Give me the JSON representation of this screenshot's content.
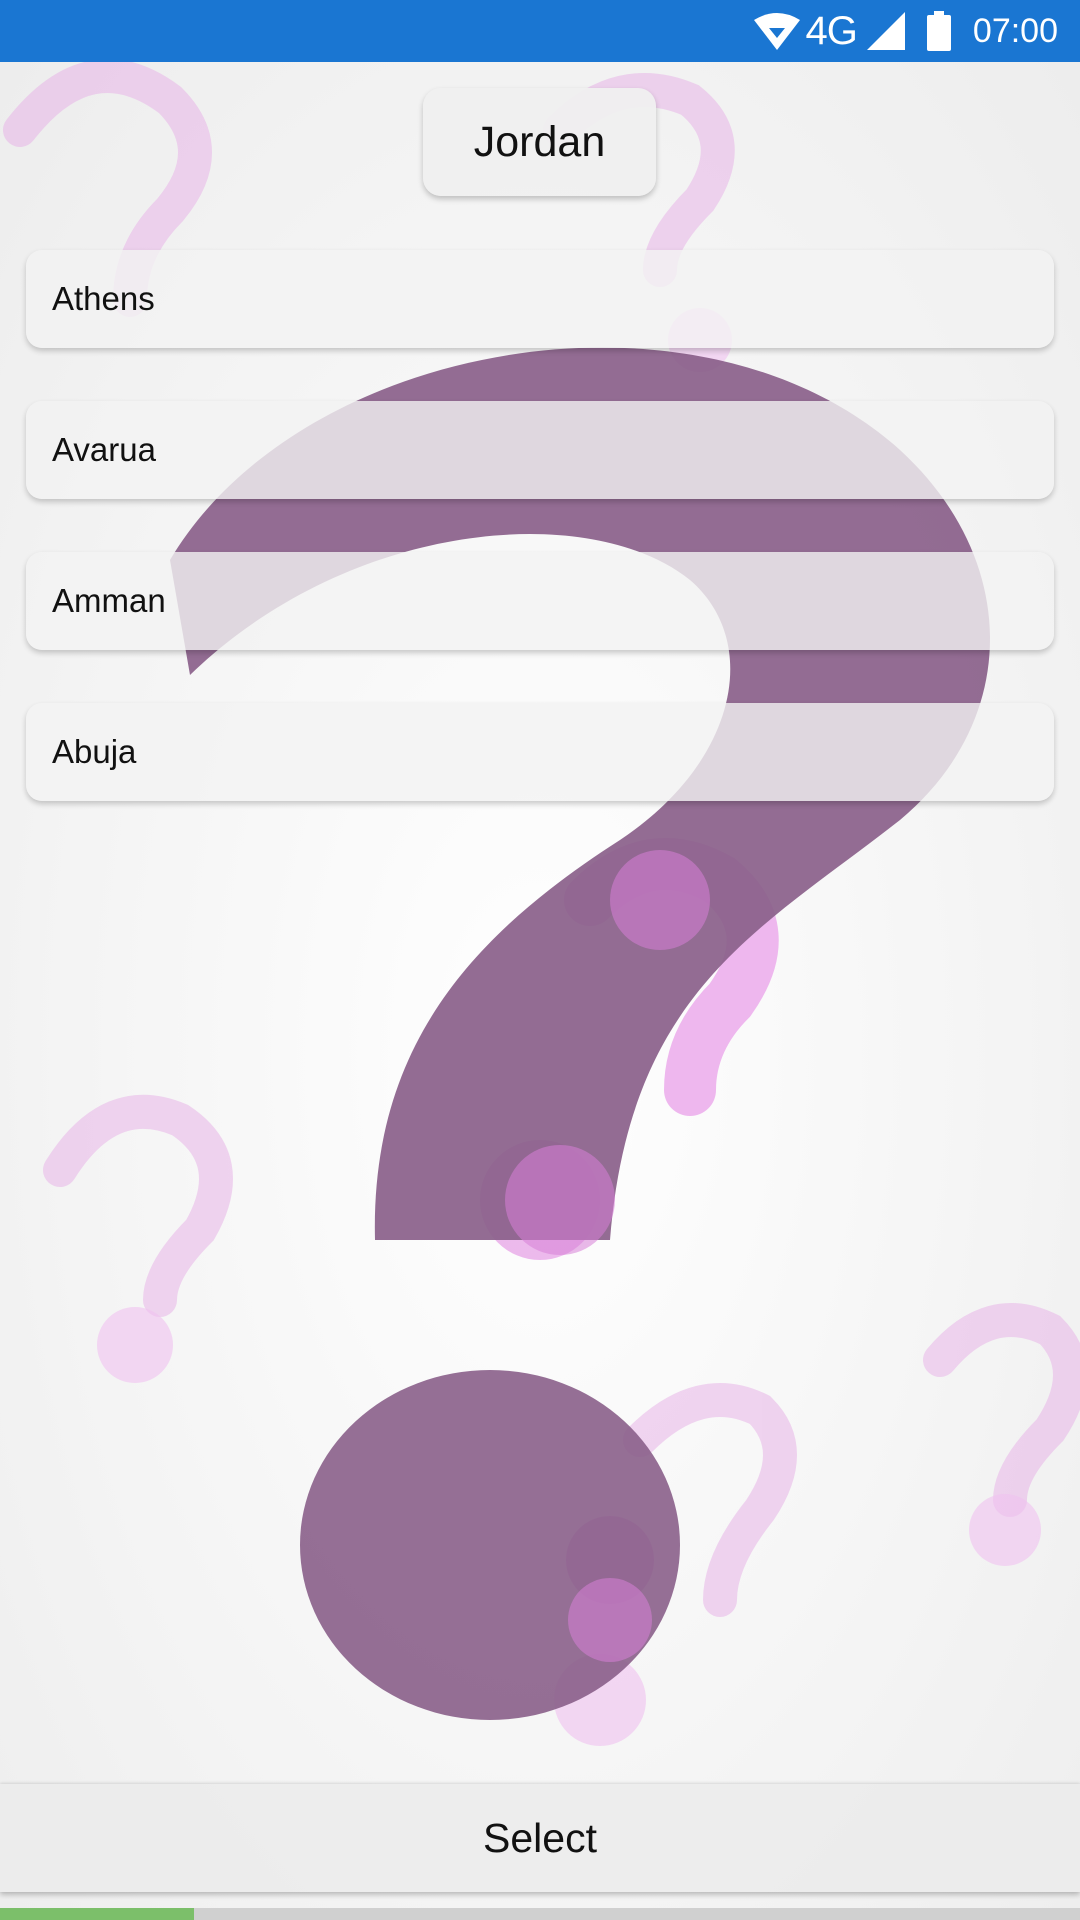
{
  "status_bar": {
    "network": "4G",
    "time": "07:00",
    "icons": [
      "wifi-icon",
      "cellular-signal-icon",
      "battery-icon"
    ]
  },
  "question": {
    "country": "Jordan"
  },
  "options": [
    {
      "label": "Athens"
    },
    {
      "label": "Avarua"
    },
    {
      "label": "Amman"
    },
    {
      "label": "Abuja"
    }
  ],
  "actions": {
    "select_label": "Select"
  },
  "progress": {
    "fraction": 0.18
  },
  "colors": {
    "status_bar": "#1a76d2",
    "progress_fill": "#7cbf6a",
    "progress_track": "#d0d0d0",
    "question_mark_main": "#8a5f8a",
    "question_mark_light": "#f2b8f2"
  }
}
